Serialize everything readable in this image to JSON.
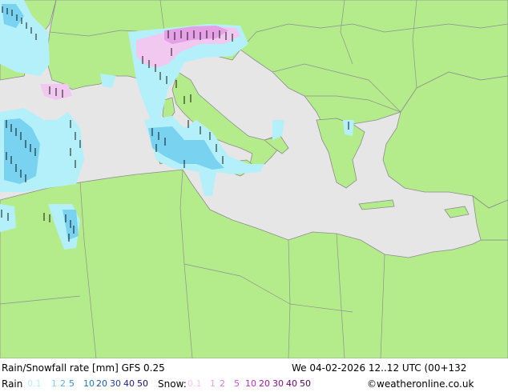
{
  "title": "Rain/Snowfall rate [mm]  GFS 0.25",
  "datetime": "We 04-02-2026 12..12 UTC (00+132",
  "credit": "©weatheronline.co.uk",
  "rain_legend": {
    "label": "Rain",
    "entries": [
      {
        "text": "0.1",
        "color": "#b4f0fa"
      },
      {
        "text": "1",
        "color": "#78d2f0"
      },
      {
        "text": "2",
        "color": "#50b4e6"
      },
      {
        "text": "5",
        "color": "#2896dc"
      },
      {
        "text": "10",
        "color": "#1e78c8"
      },
      {
        "text": "20",
        "color": "#1e5ab4"
      },
      {
        "text": "30",
        "color": "#1e3ca0"
      },
      {
        "text": "40",
        "color": "#1e1e8c"
      },
      {
        "text": "50",
        "color": "#140a6e"
      }
    ]
  },
  "snow_legend": {
    "label": "Snow:",
    "entries": [
      {
        "text": "0.1",
        "color": "#f0c8f0"
      },
      {
        "text": "1",
        "color": "#e6a0e6"
      },
      {
        "text": "2",
        "color": "#dc78dc"
      },
      {
        "text": "5",
        "color": "#d250d2"
      },
      {
        "text": "10",
        "color": "#c828c8"
      },
      {
        "text": "20",
        "color": "#aa14aa"
      },
      {
        "text": "30",
        "color": "#8c0a8c"
      },
      {
        "text": "40",
        "color": "#6e006e"
      },
      {
        "text": "50",
        "color": "#500050"
      }
    ]
  },
  "colors": {
    "sea": "#e6e6e6",
    "land": "#b4ec8c",
    "border": "#909090",
    "rain_light": "#b4f0fa",
    "rain_mid": "#78d2f0",
    "snow_light": "#f0c8f0",
    "snow_mid": "#e6a0e6"
  }
}
